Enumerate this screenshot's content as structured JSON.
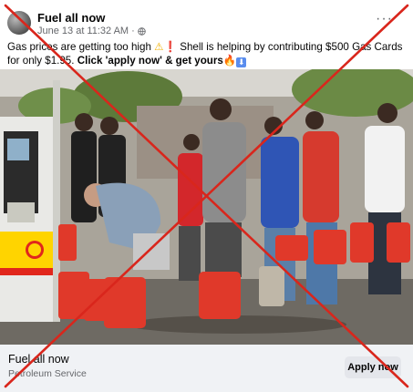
{
  "post": {
    "author": "Fuel all now",
    "timestamp": "June 13 at 11:32 AM",
    "separator": "·",
    "visibility_icon": "globe-icon",
    "more_label": "···",
    "text": {
      "part1": "Gas prices are getting too high",
      "warning_emoji": "⚠",
      "exclamation_emoji": "❗",
      "part2": "Shell is helping by contributing $500 Gas Cards for only $1.95.",
      "cta_bold": "Click 'apply now' & get yours",
      "fire_emoji": "🔥",
      "down_icon": "⬇"
    }
  },
  "ad": {
    "title": "Fuel all now",
    "subtitle": "Petroleum Service",
    "button_label": "Apply now"
  },
  "overlay": {
    "type": "red-x-cross",
    "color": "#d9261c"
  }
}
